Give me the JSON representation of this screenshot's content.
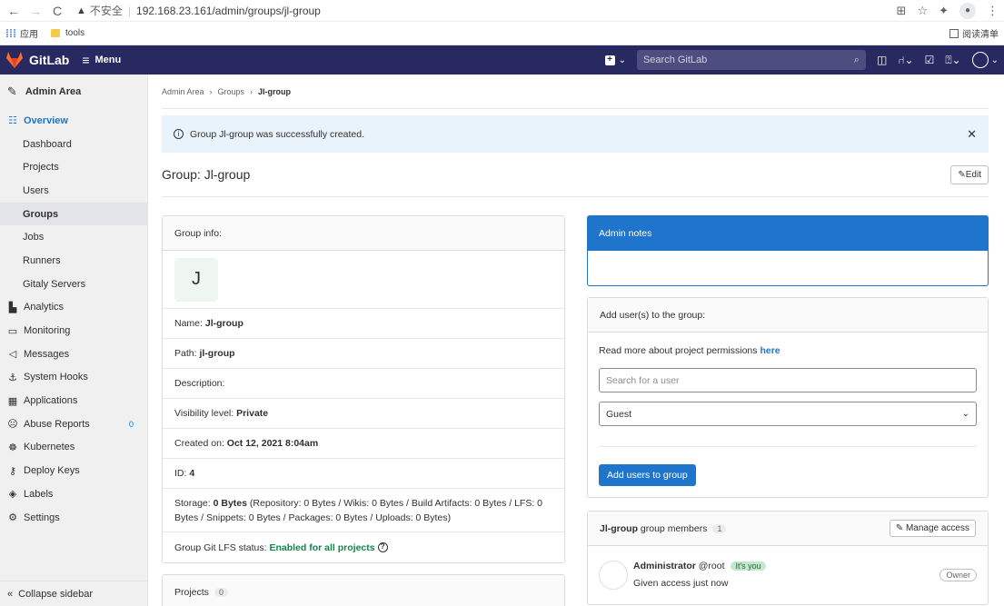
{
  "browser": {
    "back": "←",
    "forward": "→",
    "reload": "C",
    "insecure": "不安全",
    "url": "192.168.23.161/admin/groups/jl-group",
    "bookmarks": [
      {
        "label": "应用"
      },
      {
        "label": "tools"
      }
    ],
    "reading_list": "阅读清单"
  },
  "header": {
    "logo_text": "GitLab",
    "menu_label": "Menu",
    "search_placeholder": "Search GitLab"
  },
  "sidebar": {
    "title": "Admin Area",
    "overview": "Overview",
    "overview_items": [
      "Dashboard",
      "Projects",
      "Users",
      "Groups",
      "Jobs",
      "Runners",
      "Gitaly Servers"
    ],
    "items": [
      {
        "label": "Analytics",
        "icon": "analytics-icon"
      },
      {
        "label": "Monitoring",
        "icon": "monitor-icon"
      },
      {
        "label": "Messages",
        "icon": "messages-icon"
      },
      {
        "label": "System Hooks",
        "icon": "hook-icon"
      },
      {
        "label": "Applications",
        "icon": "applications-icon"
      },
      {
        "label": "Abuse Reports",
        "icon": "abuse-icon",
        "badge": "0"
      },
      {
        "label": "Kubernetes",
        "icon": "kubernetes-icon"
      },
      {
        "label": "Deploy Keys",
        "icon": "key-icon"
      },
      {
        "label": "Labels",
        "icon": "label-icon"
      },
      {
        "label": "Settings",
        "icon": "settings-icon"
      }
    ],
    "collapse": "Collapse sidebar"
  },
  "breadcrumbs": [
    "Admin Area",
    "Groups",
    "Jl-group"
  ],
  "alert": {
    "text": "Group Jl-group was successfully created."
  },
  "page": {
    "title": "Group: Jl-group",
    "edit": "Edit"
  },
  "group_info": {
    "header": "Group info:",
    "avatar_letter": "J",
    "name_label": "Name:",
    "name": "Jl-group",
    "path_label": "Path:",
    "path": "jl-group",
    "description_label": "Description:",
    "visibility_label": "Visibility level:",
    "visibility": "Private",
    "created_label": "Created on:",
    "created": "Oct 12, 2021 8:04am",
    "id_label": "ID:",
    "id": "4",
    "storage_label": "Storage:",
    "storage": "0 Bytes",
    "storage_detail": "(Repository: 0 Bytes / Wikis: 0 Bytes / Build Artifacts: 0 Bytes / LFS: 0 Bytes / Snippets: 0 Bytes / Packages: 0 Bytes / Uploads: 0 Bytes)",
    "lfs_label": "Group Git LFS status:",
    "lfs": "Enabled for all projects"
  },
  "projects": {
    "label": "Projects",
    "count": "0"
  },
  "admin_notes": {
    "header": "Admin notes"
  },
  "add_users": {
    "header": "Add user(s) to the group:",
    "permissions_text": "Read more about project permissions",
    "permissions_link": "here",
    "search_placeholder": "Search for a user",
    "role": "Guest",
    "submit": "Add users to group"
  },
  "members": {
    "group": "Jl-group",
    "label": "group members",
    "count": "1",
    "manage": "Manage access",
    "list": [
      {
        "name": "Administrator",
        "username": "@root",
        "pill": "It's you",
        "note": "Given access just now",
        "role": "Owner"
      }
    ]
  }
}
